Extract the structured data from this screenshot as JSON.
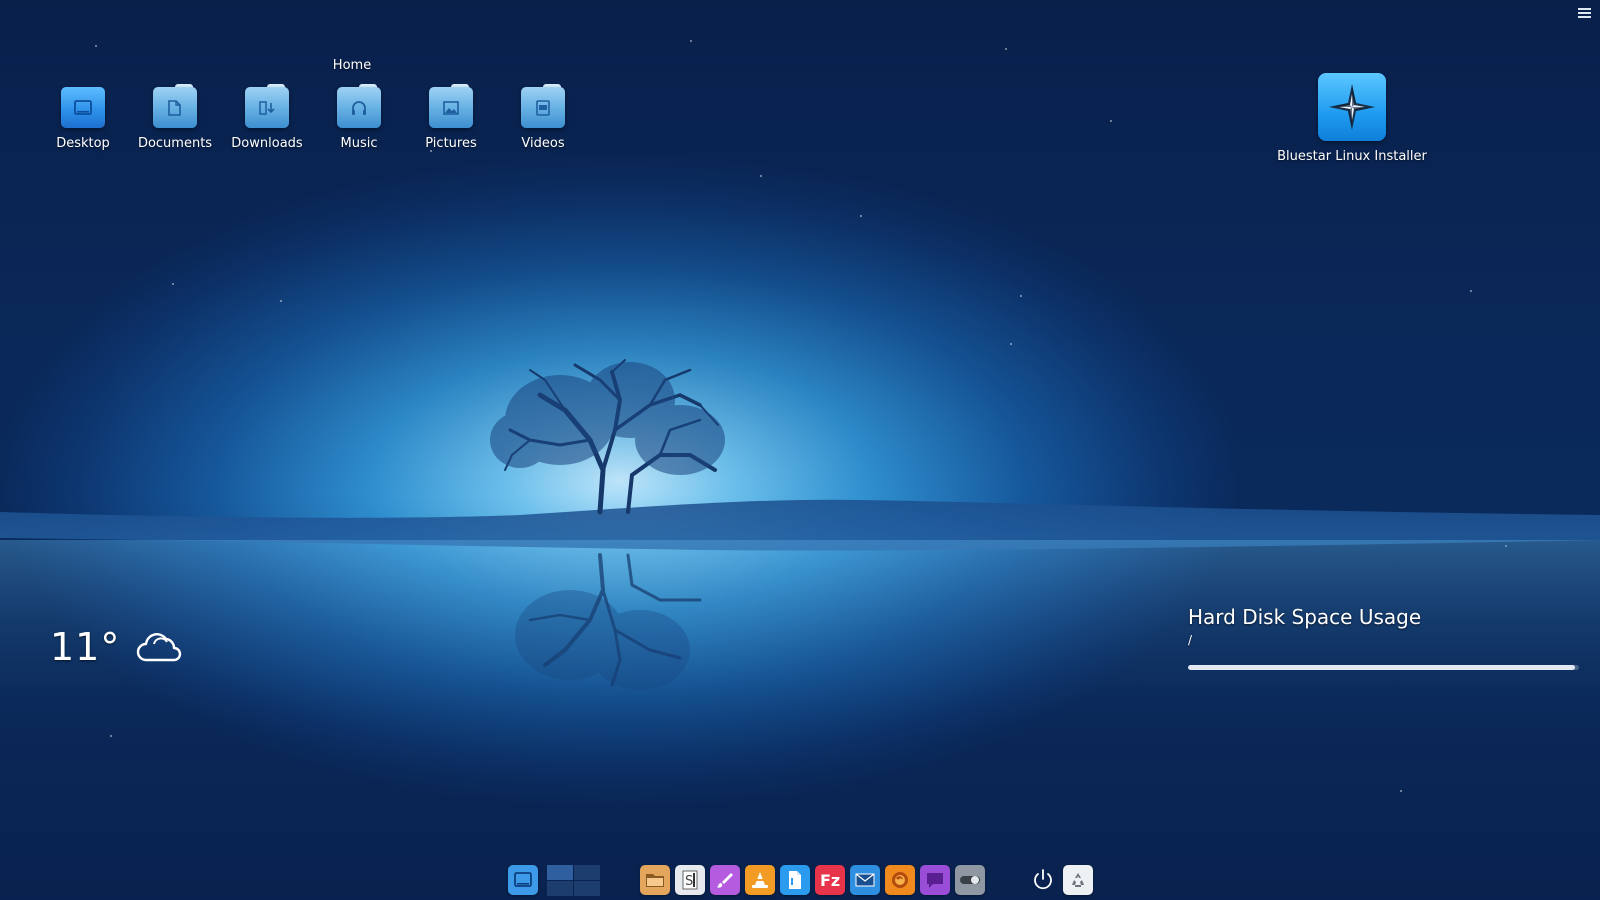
{
  "desktop": {
    "home_label": "Home",
    "icons": [
      {
        "label": "Desktop",
        "icon": "desktop-folder-icon"
      },
      {
        "label": "Documents",
        "icon": "documents-folder-icon"
      },
      {
        "label": "Downloads",
        "icon": "downloads-folder-icon"
      },
      {
        "label": "Music",
        "icon": "music-folder-icon"
      },
      {
        "label": "Pictures",
        "icon": "pictures-folder-icon"
      },
      {
        "label": "Videos",
        "icon": "videos-folder-icon"
      }
    ],
    "installer": {
      "label": "Bluestar Linux Installer",
      "icon": "compass-star-icon"
    }
  },
  "weather": {
    "temperature": "11°",
    "condition_icon": "cloudy-icon"
  },
  "disk_usage": {
    "title": "Hard Disk Space Usage",
    "path": "/",
    "fill_fraction": 0.99
  },
  "menu": {
    "icon": "hamburger-menu-icon"
  },
  "dock": {
    "items": [
      {
        "icon": "show-desktop-icon",
        "color": "#3d9ae8"
      },
      {
        "icon": "virtual-desktop-pager-icon"
      },
      {
        "icon": "file-manager-icon",
        "color": "#e4a55c"
      },
      {
        "icon": "document-scanner-icon",
        "color": "#e6e9ee"
      },
      {
        "icon": "paint-brush-icon",
        "color": "#b45be0"
      },
      {
        "icon": "vlc-cone-icon",
        "color": "#f29b25"
      },
      {
        "icon": "writer-icon",
        "color": "#2b9bf0"
      },
      {
        "icon": "filezilla-icon",
        "color": "#e8344a"
      },
      {
        "icon": "mail-client-icon",
        "color": "#2e8fe0"
      },
      {
        "icon": "firefox-icon",
        "color": "#f08a1f"
      },
      {
        "icon": "chat-icon",
        "color": "#9a4ed8"
      },
      {
        "icon": "toggle-settings-icon",
        "color": "#8f97a2"
      },
      {
        "icon": "power-icon"
      },
      {
        "icon": "trash-icon",
        "color": "#eef1f4"
      }
    ]
  },
  "colors": {
    "accent": "#1f9bf0",
    "background_dark": "#0a2a5c",
    "background_glow": "#bfe6fb"
  }
}
